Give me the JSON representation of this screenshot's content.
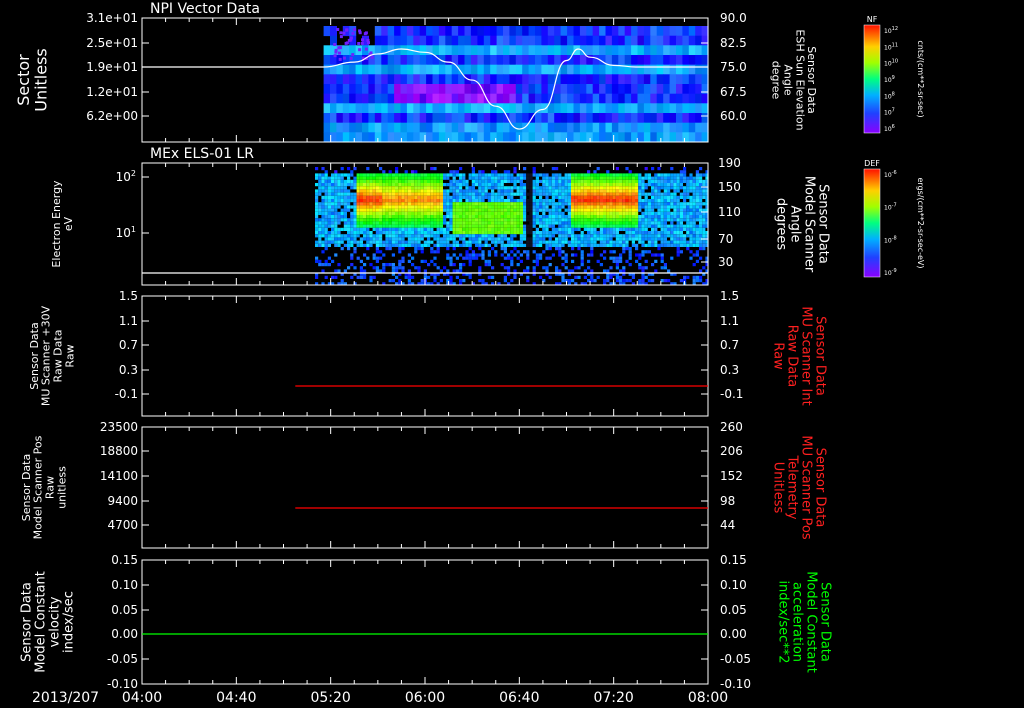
{
  "chart_data": [
    {
      "type": "heatmap",
      "title": "NPI Vector Data",
      "ylabel_left": [
        "Sector",
        "Unitless"
      ],
      "yticks_left": [
        "3.1e+01",
        "2.5e+01",
        "1.9e+01",
        "1.2e+01",
        "6.2e+00"
      ],
      "ylabel_right": [
        "Sensor Data",
        "ESH Sun Elevation",
        "Angle",
        "degree"
      ],
      "yticks_right": [
        "90.0",
        "82.5",
        "75.0",
        "67.5",
        "60.0"
      ],
      "ylim_right": [
        54,
        90
      ],
      "colorbar": {
        "label": "NF",
        "unit": "cnts/(cm**2-sr-sec)",
        "ticks": [
          "10^12",
          "10^11",
          "10^10",
          "10^9",
          "10^8",
          "10^7",
          "10^6"
        ]
      },
      "series": [
        {
          "x": [
            "04:00",
            "05:17",
            "05:30",
            "05:40",
            "05:50",
            "06:00",
            "06:10",
            "06:20",
            "06:30",
            "06:40",
            "06:50",
            "07:00",
            "07:05",
            "07:10",
            "07:20",
            "07:30",
            "08:00"
          ],
          "y": [
            75,
            75,
            76.5,
            79,
            80.5,
            79.5,
            76.5,
            71,
            63,
            56,
            62,
            77,
            80.5,
            78,
            75.5,
            75,
            75
          ]
        }
      ]
    },
    {
      "type": "heatmap",
      "title": "MEx ELS-01 LR",
      "ylabel_left": [
        "Electron Energy",
        "eV"
      ],
      "yticks_left": [
        "10^2",
        "10^1"
      ],
      "ylabel_right": [
        "Sensor Data",
        "Model Scanner",
        "Angle",
        "degrees"
      ],
      "yticks_right": [
        "190",
        "150",
        "110",
        "70",
        "30"
      ],
      "ylim_right": [
        0,
        190
      ],
      "colorbar": {
        "label": "DEF",
        "unit": "ergs/(cm**2-sr-sec-eV)",
        "ticks": [
          "10^-6",
          "10^-7",
          "10^-8",
          "10^-9"
        ]
      },
      "series": [
        {
          "x": [
            "04:00",
            "08:00"
          ],
          "y": [
            0,
            0
          ]
        }
      ]
    },
    {
      "type": "line",
      "ylabel_left": [
        "Sensor Data",
        "MU Scanner +30V",
        "Raw Data",
        "Raw"
      ],
      "yticks_left": [
        "1.5",
        "1.1",
        "0.7",
        "0.3",
        "-0.1"
      ],
      "ylabel_right": [
        "Sensor Data",
        "MU Scanner Int",
        "Raw Data",
        "Raw"
      ],
      "yticks_right": [
        "1.5",
        "1.1",
        "0.7",
        "0.3",
        "-0.1"
      ],
      "ylim": [
        -0.5,
        1.5
      ],
      "series": [
        {
          "color": "#ff0000",
          "x": [
            "05:05",
            "08:00"
          ],
          "y": [
            -0.05,
            -0.05
          ]
        }
      ]
    },
    {
      "type": "line",
      "ylabel_left": [
        "Sensor Data",
        "Model Scanner Pos",
        "Raw",
        "unitless"
      ],
      "yticks_left": [
        "23500",
        "18800",
        "14100",
        "9400",
        "4700"
      ],
      "ylabel_right": [
        "Sensor Data",
        "MU Scanner Pos",
        "Telemetry",
        "Unitless"
      ],
      "yticks_right": [
        "260",
        "206",
        "152",
        "98",
        "44"
      ],
      "ylim": [
        0,
        23500
      ],
      "series": [
        {
          "color": "#ff0000",
          "x": [
            "05:05",
            "08:00"
          ],
          "y": [
            8700,
            8700
          ]
        }
      ]
    },
    {
      "type": "line",
      "ylabel_left": [
        "Sensor Data",
        "Model Constant",
        "velocity",
        "index/sec"
      ],
      "yticks_left": [
        "0.15",
        "0.10",
        "0.05",
        "0.00",
        "-0.05",
        "-0.10"
      ],
      "ylabel_right": [
        "Sensor Data",
        "Model Constant",
        "acceleration",
        "index/sec**2"
      ],
      "yticks_right": [
        "0.15",
        "0.10",
        "0.05",
        "0.00",
        "-0.05",
        "-0.10"
      ],
      "ylim": [
        -0.1,
        0.15
      ],
      "series": [
        {
          "color": "#00ff00",
          "x": [
            "04:00",
            "08:00"
          ],
          "y": [
            0,
            0
          ]
        }
      ]
    }
  ],
  "time_axis": {
    "date": "2013/207",
    "ticks": [
      "04:00",
      "04:40",
      "05:20",
      "06:00",
      "06:40",
      "07:20",
      "08:00"
    ],
    "range": [
      "04:00",
      "08:00"
    ]
  },
  "colors": {
    "axis": "#ffffff",
    "red_trace": "#ff0000",
    "green_trace": "#00ff00",
    "background": "#000000"
  }
}
